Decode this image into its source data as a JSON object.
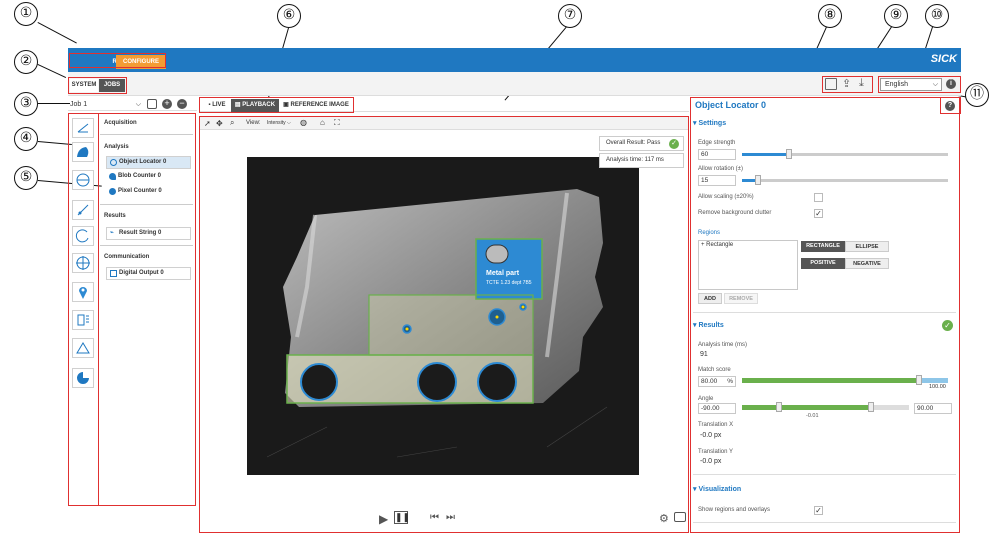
{
  "callouts": [
    "①",
    "②",
    "③",
    "④",
    "⑤",
    "⑥",
    "⑦",
    "⑧",
    "⑨",
    "⑩",
    "⑪"
  ],
  "topbar": {
    "run_label": "RUN",
    "configure_label": "CONFIGURE",
    "logo": "SICK"
  },
  "subnav": {
    "system_label": "SYSTEM",
    "jobs_label": "JOBS"
  },
  "job": {
    "selected": "Job 1"
  },
  "left_panel": {
    "acquisition": "Acquisition",
    "analysis": "Analysis",
    "analysis_items": [
      "Object Locator 0",
      "Blob Counter 0",
      "Pixel Counter 0"
    ],
    "results": "Results",
    "results_items": [
      "Result String 0"
    ],
    "communication": "Communication",
    "communication_items": [
      "Digital Output 0"
    ]
  },
  "view_tabs": {
    "live": "LIVE",
    "playback": "PLAYBACK",
    "reference": "REFERENCE IMAGE"
  },
  "image_toolbar": {
    "view_label": "View:",
    "view_value": "Intensity"
  },
  "overlay": {
    "overall": "Overall Result: Pass",
    "analysis_time": "Analysis time: 117 ms",
    "part_title": "Metal part",
    "part_sub": "TCTE 1.23 dept 7B5"
  },
  "language": {
    "selected": "English"
  },
  "right_panel": {
    "title": "Object Locator 0",
    "settings": "Settings",
    "edge_strength_label": "Edge strength",
    "edge_strength": "60",
    "edge_strength_level": 0.23,
    "allow_rotation_label": "Allow rotation (±)",
    "allow_rotation": "15",
    "allow_rotation_level": 0.08,
    "allow_scaling_label": "Allow scaling (±20%)",
    "allow_scaling_checked": false,
    "remove_clutter_label": "Remove background clutter",
    "remove_clutter_checked": true,
    "check_glyph": "✓",
    "regions_label": "Regions",
    "regions_items": [
      "+ Rectangle"
    ],
    "shape_rectangle": "RECTANGLE",
    "shape_ellipse": "ELLIPSE",
    "polarity_positive": "POSITIVE",
    "polarity_negative": "NEGATIVE",
    "add_label": "ADD",
    "remove_label": "REMOVE",
    "results": "Results",
    "analysis_time_label": "Analysis time (ms)",
    "analysis_time": "91",
    "match_score_label": "Match score",
    "match_score": "80.00",
    "match_unit": "%",
    "match_level": 0.86,
    "match_max": "100.00",
    "angle_label": "Angle",
    "angle_min": "-90.00",
    "angle_max": "90.00",
    "angle_value": "-0.01",
    "translation_x_label": "Translation X",
    "translation_x": "-0.0 px",
    "translation_y_label": "Translation Y",
    "translation_y": "-0.0 px",
    "visualization": "Visualization",
    "show_regions_label": "Show regions and overlays",
    "show_regions_checked": true
  },
  "colors": {
    "blue": "#1f78c1",
    "orange": "#f39c34",
    "green": "#6ab04c",
    "red": "#e03030"
  }
}
